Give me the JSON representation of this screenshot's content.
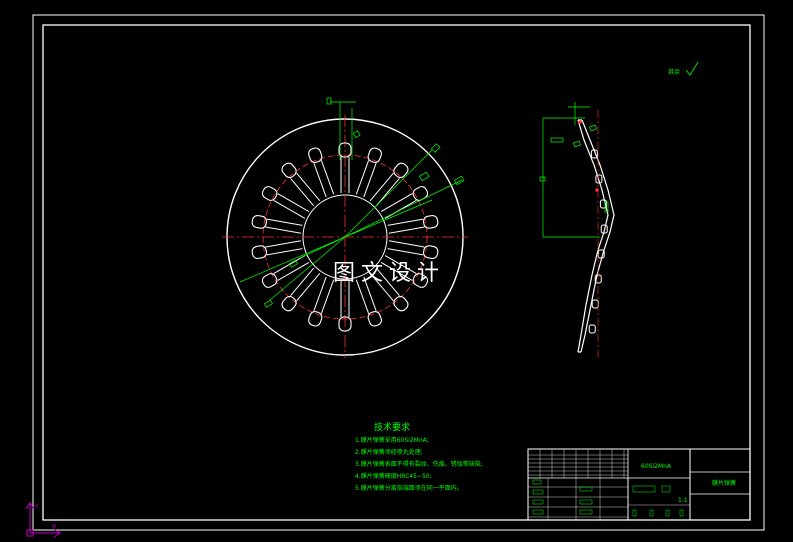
{
  "watermark": "图文设计",
  "tech_requirements": {
    "title": "技术要求",
    "items": [
      "1.膜片弹簧采用60Si2MnA;",
      "2.膜片弹簧须经喷丸处理;",
      "3.膜片弹簧表面不得有裂纹、伤痕、锈蚀等缺陷;",
      "4.膜片弹簧硬度HRC45~50;",
      "5.膜片弹簧分离指端面须在同一平面内。"
    ]
  },
  "surface_finish_note": "其余",
  "title_block": {
    "part_name": "膜片弹簧",
    "material": "60Si2MnA",
    "scale": "1:1"
  },
  "ucs": {
    "x_label": "X",
    "y_label": "Y"
  },
  "colors": {
    "background": "#000000",
    "outline": "#ffffff",
    "dimension": "#00ff00",
    "centerline": "#ff0000",
    "annotation": "#00ff00",
    "ucs": "#c000c0"
  }
}
